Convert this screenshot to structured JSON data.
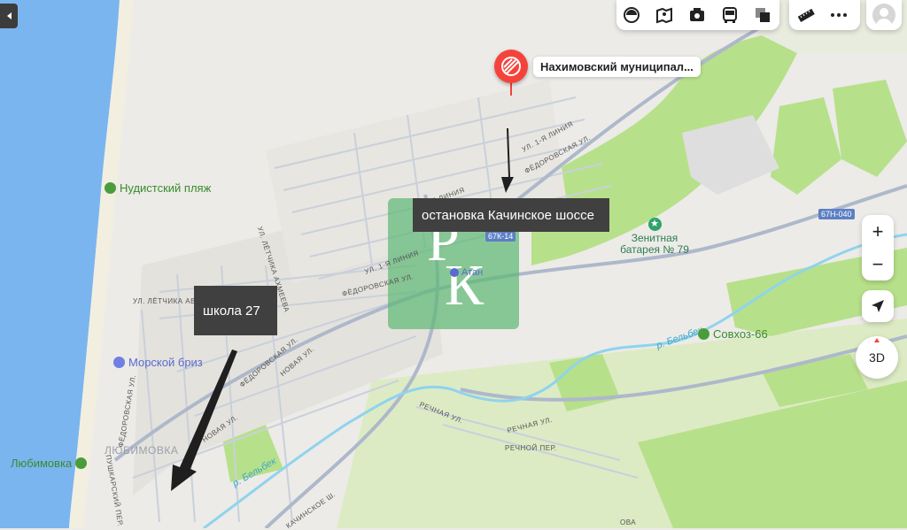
{
  "place_marker": {
    "label": "Нахимовский муниципал..."
  },
  "pois": {
    "beach": "Нудистский пляж",
    "resort": "Морской бриз",
    "village_lyubimovka": "Любимовка",
    "monument": "Зенитная батарея № 79",
    "sovkhoz": "Совхоз-66",
    "stop_atan": "Атан"
  },
  "districts": {
    "lyubimovka": "ЛЮБИМОВКА"
  },
  "streets": {
    "fedorovskaya1": "ФЁДОРОВСКАЯ УЛ.",
    "fedorovskaya2": "ФЁДОРОВСКАЯ УЛ.",
    "fedorovskaya3": "ФЁДОРОВСКАЯ УЛ.",
    "fedorovskaya4": "ФЁДОРОВСКАЯ УЛ.",
    "fedorovskaya5": "ФЁДОРОВСКАЯ УЛ.",
    "liniya1": "УЛ. 1-Я ЛИНИЯ",
    "liniya2": "УЛ. 1-Я ЛИНИЯ",
    "liniya3": "1-Я ЛИНИЯ",
    "liniya4": "УЛ. 1-Я ЛИНИЯ",
    "letchika_ahmeeva": "УЛ. ЛЁТЧИКА АХМЕЕВА",
    "letchika_avd": "УЛ. ЛЁТЧИКА АВД",
    "novaya1": "НОВАЯ УЛ.",
    "novaya2": "НОВАЯ УЛ.",
    "rechnaya1": "РЕЧНАЯ УЛ.",
    "rechnaya2": "РЕЧНАЯ УЛ.",
    "rechnoy_per": "РЕЧНОЙ ПЕР.",
    "pushkarsky": "ПУШКАРСКИЙ ПЕР.",
    "kachinskoe": "КАЧИНСКОЕ Ш.",
    "ova": "ОВА"
  },
  "rivers": {
    "belbek1": "р. Бельбек",
    "belbek2": "р. Бельбек"
  },
  "road_badges": {
    "r1": "67Н-040",
    "r2": "67К-14"
  },
  "annotations": {
    "bus_stop": "остановка Качинское шоссе",
    "school": "школа 27"
  },
  "watermark": {
    "top": "Р",
    "bottom": "К"
  },
  "toolbar": {
    "layers": "layers-icon",
    "panorama": "panorama-icon",
    "photo": "camera-icon",
    "transport": "bus-icon",
    "scheme": "map-type-icon",
    "ruler": "ruler-icon",
    "more": "more-icon"
  },
  "controls": {
    "zoom_in": "+",
    "zoom_out": "−",
    "view_3d": "3D"
  },
  "colors": {
    "sea": "#7bb5ef",
    "beach": "#f2efe0",
    "forest": "#b7e08a",
    "river": "#8fd3ee",
    "road": "#aeb8cb",
    "marker": "#f5433b",
    "annotation": "#404040",
    "watermark": "#5fb877"
  }
}
